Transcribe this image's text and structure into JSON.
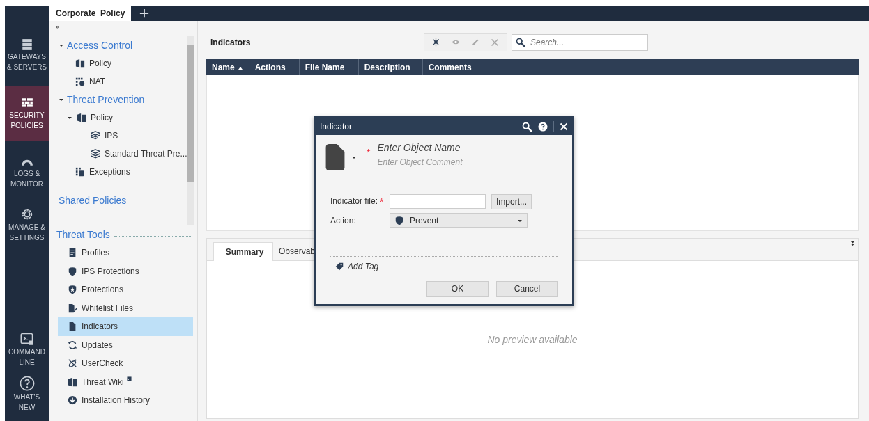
{
  "tab": {
    "label": "Corporate_Policy",
    "selected": true
  },
  "rail": {
    "items": [
      {
        "lines": [
          "GATEWAYS",
          "& SERVERS"
        ],
        "selected": false
      },
      {
        "lines": [
          "SECURITY",
          "POLICIES"
        ],
        "selected": true
      },
      {
        "lines": [
          "LOGS &",
          "MONITOR"
        ],
        "selected": false
      },
      {
        "lines": [
          "MANAGE &",
          "SETTINGS"
        ],
        "selected": false
      }
    ],
    "bottom_items": [
      {
        "lines": [
          "COMMAND",
          "LINE"
        ],
        "selected": false
      },
      {
        "lines": [
          "WHAT'S",
          "NEW"
        ],
        "selected": false
      }
    ]
  },
  "tree": [
    {
      "label": "Access Control",
      "expanded": true,
      "children": [
        {
          "label": "Policy"
        },
        {
          "label": "NAT"
        }
      ]
    },
    {
      "label": "Threat Prevention",
      "expanded": true,
      "children": [
        {
          "label": "Policy",
          "expanded": true,
          "children": [
            {
              "label": "IPS"
            },
            {
              "label": "Standard Threat Pre..."
            }
          ]
        },
        {
          "label": "Exceptions"
        }
      ]
    }
  ],
  "shared_policies": {
    "title": "Shared Policies"
  },
  "threat_tools": {
    "title": "Threat Tools",
    "items": [
      {
        "label": "Profiles",
        "selected": false
      },
      {
        "label": "IPS Protections",
        "selected": false
      },
      {
        "label": "Protections",
        "selected": false
      },
      {
        "label": "Whitelist Files",
        "selected": false
      },
      {
        "label": "Indicators",
        "selected": true
      },
      {
        "label": "Updates",
        "selected": false
      },
      {
        "label": "UserCheck",
        "selected": false
      },
      {
        "label": "Threat Wiki",
        "selected": false,
        "external": true
      },
      {
        "label": "Installation History",
        "selected": false
      }
    ]
  },
  "main": {
    "title": "Indicators",
    "toolbar": [
      {
        "disabled": false
      },
      {
        "disabled": true
      },
      {
        "disabled": true
      },
      {
        "disabled": true
      }
    ],
    "search": {
      "placeholder": "Search..."
    },
    "table": {
      "columns": [
        {
          "label": "Name",
          "sorted": true
        },
        {
          "label": "Actions",
          "sorted": false
        },
        {
          "label": "File Name",
          "sorted": false
        },
        {
          "label": "Description",
          "sorted": false
        },
        {
          "label": "Comments",
          "sorted": false
        }
      ]
    }
  },
  "details": {
    "tabs": [
      {
        "label": "Summary",
        "selected": true
      },
      {
        "label": "Observab",
        "selected": false
      }
    ],
    "empty_message": "No preview available"
  },
  "dialog": {
    "title": "Indicator",
    "required_mark": "*",
    "name_placeholder": "Enter Object Name",
    "comment_placeholder": "Enter Object Comment",
    "fields": [
      {
        "label": "Indicator file:",
        "required": true,
        "kind": "file",
        "button": "Import..."
      },
      {
        "label": "Action:",
        "required": false,
        "kind": "select",
        "value": "Prevent"
      }
    ],
    "add_tag": "Add Tag",
    "buttons": [
      "OK",
      "Cancel"
    ]
  }
}
